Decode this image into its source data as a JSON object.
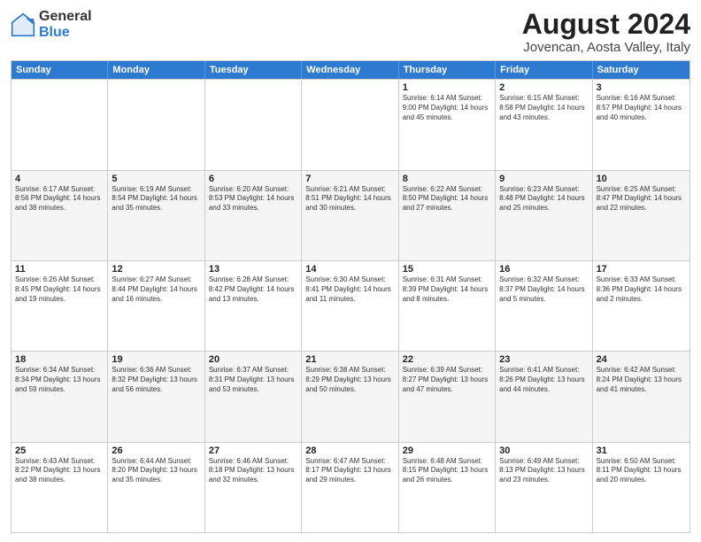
{
  "logo": {
    "line1": "General",
    "line2": "Blue"
  },
  "title": "August 2024",
  "subtitle": "Jovencan, Aosta Valley, Italy",
  "weekdays": [
    "Sunday",
    "Monday",
    "Tuesday",
    "Wednesday",
    "Thursday",
    "Friday",
    "Saturday"
  ],
  "rows": [
    [
      {
        "day": "",
        "info": ""
      },
      {
        "day": "",
        "info": ""
      },
      {
        "day": "",
        "info": ""
      },
      {
        "day": "",
        "info": ""
      },
      {
        "day": "1",
        "info": "Sunrise: 6:14 AM\nSunset: 9:00 PM\nDaylight: 14 hours\nand 45 minutes."
      },
      {
        "day": "2",
        "info": "Sunrise: 6:15 AM\nSunset: 8:58 PM\nDaylight: 14 hours\nand 43 minutes."
      },
      {
        "day": "3",
        "info": "Sunrise: 6:16 AM\nSunset: 8:57 PM\nDaylight: 14 hours\nand 40 minutes."
      }
    ],
    [
      {
        "day": "4",
        "info": "Sunrise: 6:17 AM\nSunset: 8:56 PM\nDaylight: 14 hours\nand 38 minutes."
      },
      {
        "day": "5",
        "info": "Sunrise: 6:19 AM\nSunset: 8:54 PM\nDaylight: 14 hours\nand 35 minutes."
      },
      {
        "day": "6",
        "info": "Sunrise: 6:20 AM\nSunset: 8:53 PM\nDaylight: 14 hours\nand 33 minutes."
      },
      {
        "day": "7",
        "info": "Sunrise: 6:21 AM\nSunset: 8:51 PM\nDaylight: 14 hours\nand 30 minutes."
      },
      {
        "day": "8",
        "info": "Sunrise: 6:22 AM\nSunset: 8:50 PM\nDaylight: 14 hours\nand 27 minutes."
      },
      {
        "day": "9",
        "info": "Sunrise: 6:23 AM\nSunset: 8:48 PM\nDaylight: 14 hours\nand 25 minutes."
      },
      {
        "day": "10",
        "info": "Sunrise: 6:25 AM\nSunset: 8:47 PM\nDaylight: 14 hours\nand 22 minutes."
      }
    ],
    [
      {
        "day": "11",
        "info": "Sunrise: 6:26 AM\nSunset: 8:45 PM\nDaylight: 14 hours\nand 19 minutes."
      },
      {
        "day": "12",
        "info": "Sunrise: 6:27 AM\nSunset: 8:44 PM\nDaylight: 14 hours\nand 16 minutes."
      },
      {
        "day": "13",
        "info": "Sunrise: 6:28 AM\nSunset: 8:42 PM\nDaylight: 14 hours\nand 13 minutes."
      },
      {
        "day": "14",
        "info": "Sunrise: 6:30 AM\nSunset: 8:41 PM\nDaylight: 14 hours\nand 11 minutes."
      },
      {
        "day": "15",
        "info": "Sunrise: 6:31 AM\nSunset: 8:39 PM\nDaylight: 14 hours\nand 8 minutes."
      },
      {
        "day": "16",
        "info": "Sunrise: 6:32 AM\nSunset: 8:37 PM\nDaylight: 14 hours\nand 5 minutes."
      },
      {
        "day": "17",
        "info": "Sunrise: 6:33 AM\nSunset: 8:36 PM\nDaylight: 14 hours\nand 2 minutes."
      }
    ],
    [
      {
        "day": "18",
        "info": "Sunrise: 6:34 AM\nSunset: 8:34 PM\nDaylight: 13 hours\nand 59 minutes."
      },
      {
        "day": "19",
        "info": "Sunrise: 6:36 AM\nSunset: 8:32 PM\nDaylight: 13 hours\nand 56 minutes."
      },
      {
        "day": "20",
        "info": "Sunrise: 6:37 AM\nSunset: 8:31 PM\nDaylight: 13 hours\nand 53 minutes."
      },
      {
        "day": "21",
        "info": "Sunrise: 6:38 AM\nSunset: 8:29 PM\nDaylight: 13 hours\nand 50 minutes."
      },
      {
        "day": "22",
        "info": "Sunrise: 6:39 AM\nSunset: 8:27 PM\nDaylight: 13 hours\nand 47 minutes."
      },
      {
        "day": "23",
        "info": "Sunrise: 6:41 AM\nSunset: 8:26 PM\nDaylight: 13 hours\nand 44 minutes."
      },
      {
        "day": "24",
        "info": "Sunrise: 6:42 AM\nSunset: 8:24 PM\nDaylight: 13 hours\nand 41 minutes."
      }
    ],
    [
      {
        "day": "25",
        "info": "Sunrise: 6:43 AM\nSunset: 8:22 PM\nDaylight: 13 hours\nand 38 minutes."
      },
      {
        "day": "26",
        "info": "Sunrise: 6:44 AM\nSunset: 8:20 PM\nDaylight: 13 hours\nand 35 minutes."
      },
      {
        "day": "27",
        "info": "Sunrise: 6:46 AM\nSunset: 8:18 PM\nDaylight: 13 hours\nand 32 minutes."
      },
      {
        "day": "28",
        "info": "Sunrise: 6:47 AM\nSunset: 8:17 PM\nDaylight: 13 hours\nand 29 minutes."
      },
      {
        "day": "29",
        "info": "Sunrise: 6:48 AM\nSunset: 8:15 PM\nDaylight: 13 hours\nand 26 minutes."
      },
      {
        "day": "30",
        "info": "Sunrise: 6:49 AM\nSunset: 8:13 PM\nDaylight: 13 hours\nand 23 minutes."
      },
      {
        "day": "31",
        "info": "Sunrise: 6:50 AM\nSunset: 8:11 PM\nDaylight: 13 hours\nand 20 minutes."
      }
    ]
  ]
}
